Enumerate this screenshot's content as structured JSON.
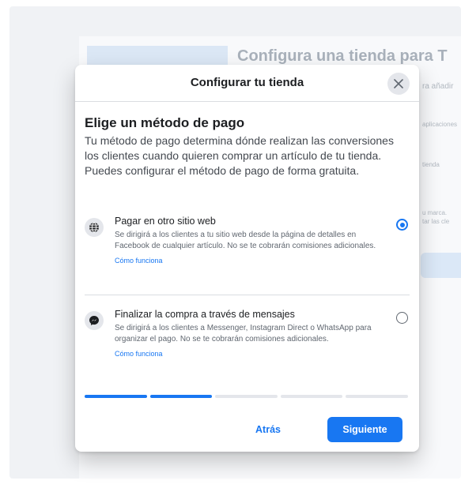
{
  "background": {
    "title": "Configura una tienda para T",
    "lines": [
      "ra añadir",
      "aplicaciones",
      "tienda",
      "u marca.",
      "tar las cle"
    ]
  },
  "modal": {
    "title": "Configurar tu tienda",
    "heading": "Elige un método de pago",
    "description": "Tu método de pago determina dónde realizan las conversiones los clientes cuando quieren comprar un artículo de tu tienda. Puedes configurar el método de pago de forma gratuita.",
    "options": [
      {
        "title": "Pagar en otro sitio web",
        "description": "Se dirigirá a los clientes a tu sitio web desde la página de detalles en Facebook de cualquier artículo. No se te cobrarán comisiones adicionales.",
        "link": "Cómo funciona",
        "icon": "globe-icon",
        "selected": true
      },
      {
        "title": "Finalizar la compra a través de mensajes",
        "description": "Se dirigirá a los clientes a Messenger, Instagram Direct o WhatsApp para organizar el pago. No se te cobrarán comisiones adicionales.",
        "link": "Cómo funciona",
        "icon": "messenger-icon",
        "selected": false
      }
    ],
    "progress": {
      "total_steps": 5,
      "completed_steps": 2
    },
    "buttons": {
      "back": "Atrás",
      "next": "Siguiente"
    }
  },
  "colors": {
    "accent": "#1877f2",
    "backdrop": "#f0f2f5",
    "text": "#1c1e21"
  }
}
